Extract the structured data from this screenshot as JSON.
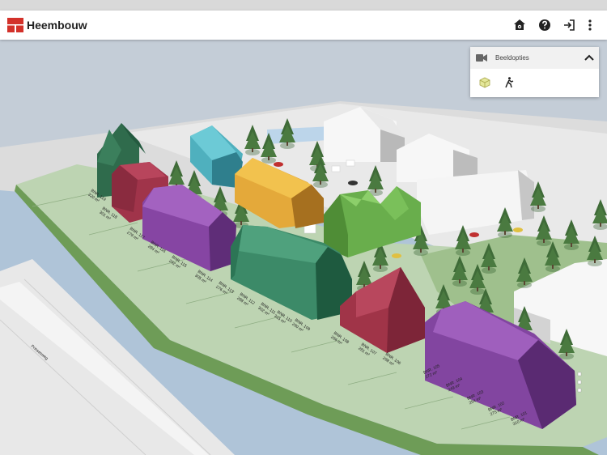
{
  "app": {
    "name": "Heembouw"
  },
  "toolbar": {
    "icons": [
      "home-settings-icon",
      "help-icon",
      "logout-icon",
      "more-vert-icon"
    ]
  },
  "view_panel": {
    "title": "Beeldopties",
    "icons": [
      "camera-icon",
      "chevron-up-icon",
      "cube-view-icon",
      "walk-view-icon"
    ]
  },
  "map": {
    "street_label": "Prinsesweg"
  },
  "plots": [
    {
      "name": "BNR. 101",
      "area": "310 m²"
    },
    {
      "name": "BNR. 102",
      "area": "275 m²"
    },
    {
      "name": "BNR. 103",
      "area": "254 m²"
    },
    {
      "name": "BNR. 104",
      "area": "249 m²"
    },
    {
      "name": "BNR. 105",
      "area": "272 m²"
    },
    {
      "name": "BNR. 106",
      "area": "298 m²"
    },
    {
      "name": "BNR. 107",
      "area": "281 m²"
    },
    {
      "name": "BNR. 108",
      "area": "266 m²"
    },
    {
      "name": "BNR. 109",
      "area": "290 m²"
    },
    {
      "name": "BNR. 110",
      "area": "315 m²"
    },
    {
      "name": "BNR. 111",
      "area": "302 m²"
    },
    {
      "name": "BNR. 112",
      "area": "288 m²"
    },
    {
      "name": "BNR. 113",
      "area": "276 m²"
    },
    {
      "name": "BNR. 114",
      "area": "305 m²"
    },
    {
      "name": "BNR. 115",
      "area": "292 m²"
    },
    {
      "name": "BNR. 116",
      "area": "284 m²"
    },
    {
      "name": "BNR. 117",
      "area": "279 m²"
    },
    {
      "name": "BNR. 118",
      "area": "301 m²"
    },
    {
      "name": "BNR. 119",
      "area": "320 m²"
    }
  ],
  "colors": {
    "brand_red": "#d3312a",
    "grass": "#a9c79a",
    "water": "#aec4d8",
    "purple": "#8a46a6",
    "crimson": "#a2384a",
    "teal": "#3d8c6c",
    "cyan": "#52b7c4",
    "yellow": "#e7b33e",
    "lime": "#6ab14e"
  }
}
